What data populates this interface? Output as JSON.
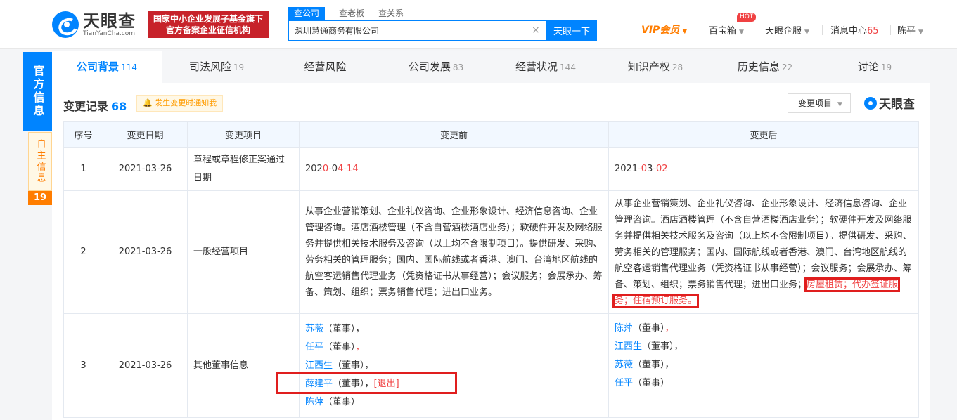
{
  "header": {
    "logo_cn": "天眼查",
    "logo_en": "TianYanCha.com",
    "promo_line1": "国家中小企业发展子基金旗下",
    "promo_line2": "官方备案企业征信机构",
    "search_tabs": [
      "查公司",
      "查老板",
      "查关系"
    ],
    "search_value": "深圳慧通商务有限公司",
    "search_button": "天眼一下",
    "vip": "VIP会员",
    "treasure": "百宝箱",
    "hot": "HOT",
    "enterprise": "天眼企服",
    "messages": "消息中心",
    "message_count": "65",
    "user": "陈平"
  },
  "side": {
    "official": "官方信息",
    "self": "自主信息",
    "self_count": "19"
  },
  "tabs": [
    {
      "label": "公司背景",
      "count": "114"
    },
    {
      "label": "司法风险",
      "count": "19"
    },
    {
      "label": "经营风险",
      "count": ""
    },
    {
      "label": "公司发展",
      "count": "83"
    },
    {
      "label": "经营状况",
      "count": "144"
    },
    {
      "label": "知识产权",
      "count": "28"
    },
    {
      "label": "历史信息",
      "count": "22"
    },
    {
      "label": "讨论",
      "count": "19"
    }
  ],
  "section": {
    "title": "变更记录",
    "count": "68",
    "notify": "发生变更时通知我",
    "filter": "变更项目",
    "brand": "天眼查"
  },
  "table": {
    "headers": [
      "序号",
      "变更日期",
      "变更项目",
      "变更前",
      "变更后"
    ],
    "row1": {
      "no": "1",
      "date": "2021-03-26",
      "item": "章程或章程修正案通过日期",
      "before_a": "202",
      "before_b": "0",
      "before_c": "-0",
      "before_d": "4-14",
      "after_a": "2021",
      "after_b": "-0",
      "after_c": "3",
      "after_d": "-02"
    },
    "row2": {
      "no": "2",
      "date": "2021-03-26",
      "item": "一般经营项目",
      "before": "从事企业营销策划、企业礼仪咨询、企业形象设计、经济信息咨询、企业管理咨询。酒店酒楼管理（不含自营酒楼酒店业务）；软硬件开发及网络服务并提供相关技术服务及咨询（以上均不含限制项目）。提供研发、采购、劳务相关的管理服务；国内、国际航线或者香港、澳门、台湾地区航线的航空客运销售代理业务（凭资格证书从事经营）；会议服务；会展承办、筹备、策划、组织；票务销售代理；进出口业务。",
      "after": "从事企业营销策划、企业礼仪咨询、企业形象设计、经济信息咨询、企业管理咨询。酒店酒楼管理（不含自营酒楼酒店业务）；软硬件开发及网络服务并提供相关技术服务及咨询（以上均不含限制项目）。提供研发、采购、劳务相关的管理服务；国内、国际航线或者香港、澳门、台湾地区航线的航空客运销售代理业务（凭资格证书从事经营）；会议服务；会展承办、筹备、策划、组织；票务销售代理；进出口业务；",
      "after_added": "房屋租赁；代办签证服务；住宿预订服务。"
    },
    "row3": {
      "no": "3",
      "date": "2021-03-26",
      "item": "其他董事信息",
      "before": [
        {
          "name": "苏薇",
          "role": "（董事）",
          "suffix": "，",
          "suffix_red": ""
        },
        {
          "name": "任平",
          "role": "（董事）",
          "suffix": "",
          "suffix_red": "，"
        },
        {
          "name": "江西生",
          "role": "（董事）",
          "suffix": "，",
          "suffix_red": ""
        },
        {
          "name": "薛建平",
          "role": "（董事）",
          "suffix": "，",
          "suffix_red": "[退出]"
        },
        {
          "name": "陈萍",
          "role": "（董事）",
          "suffix": "",
          "suffix_red": ""
        }
      ],
      "after": [
        {
          "name": "陈萍",
          "role": "（董事）",
          "suffix": "",
          "suffix_red": "，"
        },
        {
          "name": "江西生",
          "role": "（董事）",
          "suffix": "，",
          "suffix_red": ""
        },
        {
          "name": "苏薇",
          "role": "（董事）",
          "suffix": "，",
          "suffix_red": ""
        },
        {
          "name": "任平",
          "role": "（董事）",
          "suffix": "",
          "suffix_red": ""
        }
      ]
    }
  }
}
